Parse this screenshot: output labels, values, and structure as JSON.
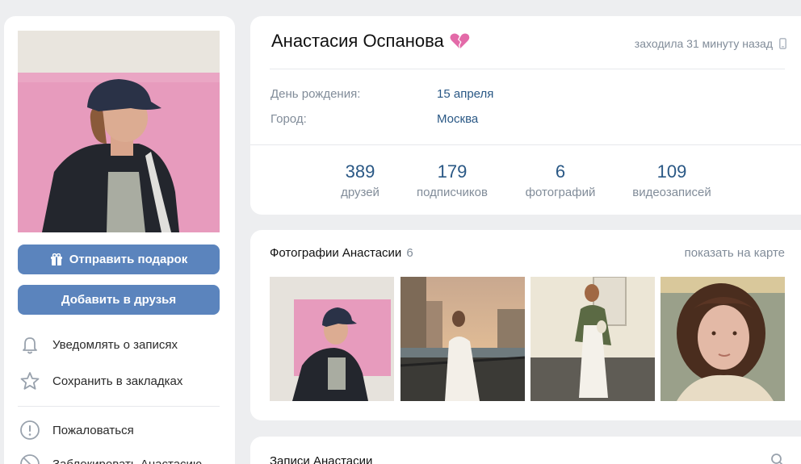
{
  "profile": {
    "name": "Анастасия Оспанова",
    "last_seen": "заходила 31 минуту назад",
    "birthday_label": "День рождения:",
    "birthday_value": "15 апреля",
    "city_label": "Город:",
    "city_value": "Москва",
    "counters": [
      {
        "num": "389",
        "label": "друзей"
      },
      {
        "num": "179",
        "label": "подписчиков"
      },
      {
        "num": "6",
        "label": "фотографий"
      },
      {
        "num": "109",
        "label": "видеозаписей"
      }
    ]
  },
  "left": {
    "gift_button": "Отправить подарок",
    "add_friend_button": "Добавить в друзья",
    "actions": {
      "notify": "Уведомлять о записях",
      "bookmark": "Сохранить в закладках",
      "report": "Пожаловаться",
      "block": "Заблокировать Анастасию"
    }
  },
  "photos": {
    "title": "Фотографии Анастасии",
    "count": "6",
    "map_link": "показать на карте"
  },
  "posts": {
    "title": "Записи Анастасии"
  },
  "colors": {
    "accent": "#5b84bd",
    "link": "#2a5885",
    "muted": "#818c99",
    "background": "#edeef0"
  },
  "icons": [
    "gift-icon",
    "bell-icon",
    "star-icon",
    "alert-icon",
    "block-icon",
    "broken-heart-icon",
    "phone-icon",
    "search-icon"
  ]
}
